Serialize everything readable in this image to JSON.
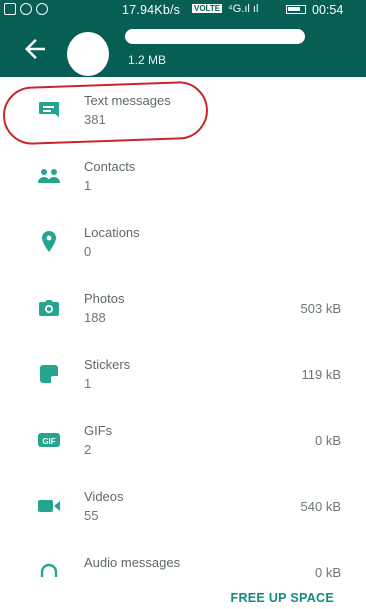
{
  "status_bar": {
    "speed": "17.94Kb/s",
    "volte": "VOLTE",
    "signal": "⁴G.ıl ıl",
    "time": "00:54"
  },
  "header": {
    "size": "1.2 MB"
  },
  "items": [
    {
      "title": "Text messages",
      "count": "381",
      "size": ""
    },
    {
      "title": "Contacts",
      "count": "1",
      "size": ""
    },
    {
      "title": "Locations",
      "count": "0",
      "size": ""
    },
    {
      "title": "Photos",
      "count": "188",
      "size": "503 kB"
    },
    {
      "title": "Stickers",
      "count": "1",
      "size": "119 kB"
    },
    {
      "title": "GIFs",
      "count": "2",
      "size": "0 kB"
    },
    {
      "title": "Videos",
      "count": "55",
      "size": "540 kB"
    },
    {
      "title": "Audio messages",
      "count": "",
      "size": "0 kB"
    }
  ],
  "footer": {
    "free_up_label": "FREE UP SPACE"
  },
  "colors": {
    "primary": "#075E54",
    "accent": "#128C7E",
    "icon": "#25a58f",
    "annotation": "#c8262b"
  }
}
